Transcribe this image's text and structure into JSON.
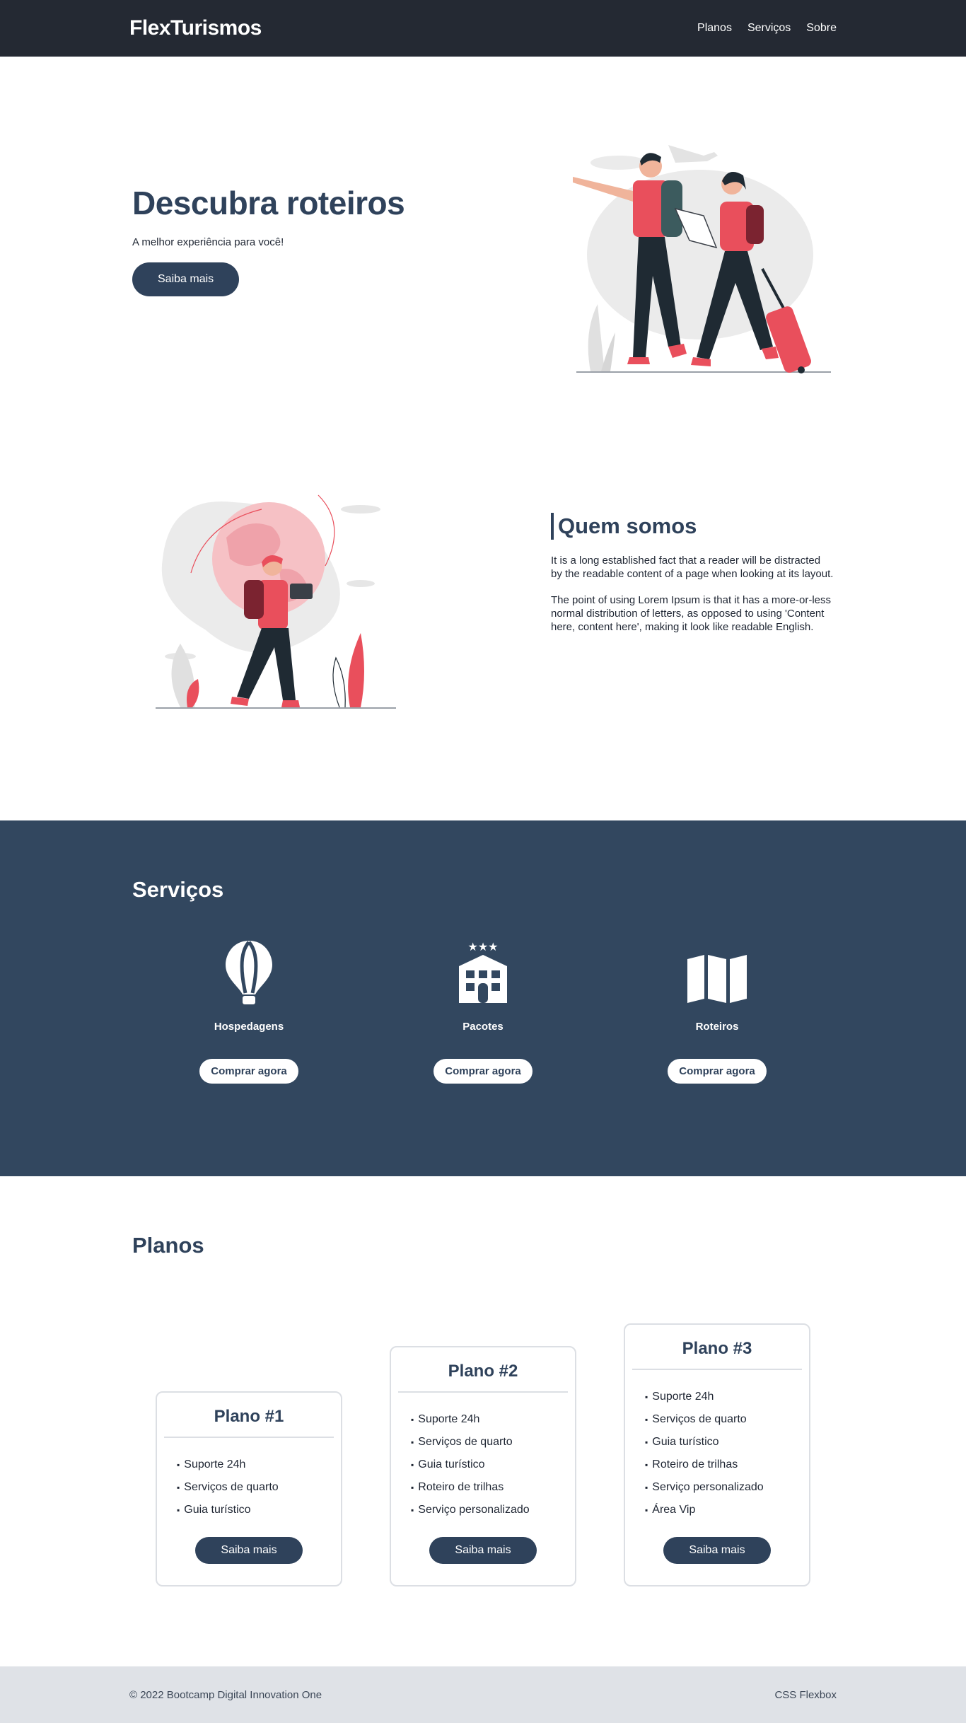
{
  "header": {
    "logo": "FlexTurismos",
    "nav": [
      "Planos",
      "Serviços",
      "Sobre"
    ]
  },
  "hero": {
    "title": "Descubra roteiros",
    "subtitle": "A melhor experiência para você!",
    "button": "Saiba mais"
  },
  "about": {
    "title": "Quem somos",
    "paragraphs": [
      "It is a long established fact that a reader will be distracted by the readable content of a page when looking at its layout.",
      "The point of using Lorem Ipsum is that it has a more-or-less normal distribution of letters, as opposed to using 'Content here, content here', making it look like readable English."
    ]
  },
  "services": {
    "title": "Serviços",
    "items": [
      {
        "name": "Hospedagens",
        "icon": "hot-air-balloon-icon",
        "button": "Comprar agora"
      },
      {
        "name": "Pacotes",
        "icon": "hotel-icon",
        "button": "Comprar agora"
      },
      {
        "name": "Roteiros",
        "icon": "map-icon",
        "button": "Comprar agora"
      }
    ]
  },
  "plans": {
    "title": "Planos",
    "items": [
      {
        "title": "Plano #1",
        "features": [
          "Suporte 24h",
          "Serviços de quarto",
          "Guia turístico"
        ],
        "button": "Saiba mais"
      },
      {
        "title": "Plano #2",
        "features": [
          "Suporte 24h",
          "Serviços de quarto",
          "Guia turístico",
          "Roteiro de trilhas",
          "Serviço personalizado"
        ],
        "button": "Saiba mais"
      },
      {
        "title": "Plano #3",
        "features": [
          "Suporte 24h",
          "Serviços de quarto",
          "Guia turístico",
          "Roteiro de trilhas",
          "Serviço personalizado",
          "Área Vip"
        ],
        "button": "Saiba mais"
      }
    ]
  },
  "footer": {
    "copyright": "© 2022 Bootcamp Digital Innovation One",
    "right": "CSS Flexbox"
  },
  "colors": {
    "header_bg": "#242933",
    "primary": "#2f425b",
    "services_bg": "#32475f",
    "accent_red": "#e94f5c",
    "footer_bg": "#dfe2e7"
  }
}
